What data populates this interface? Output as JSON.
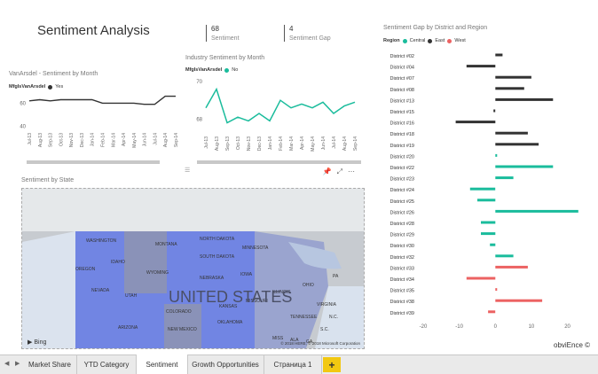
{
  "report": {
    "title": "Sentiment Analysis",
    "kpis": [
      {
        "value": "68",
        "label": "Sentiment"
      },
      {
        "value": "4",
        "label": "Sentiment Gap"
      }
    ],
    "branding": "obviEnce ©"
  },
  "vanarsdel_chart": {
    "title": "VanArsdel - Sentiment by Month",
    "legend_title": "MfgIsVanArsdel",
    "legend_item": "Yes",
    "color": "#333333",
    "chart_data": {
      "type": "line",
      "categories": [
        "Jul-13",
        "Aug-13",
        "Sep-13",
        "Oct-13",
        "Nov-13",
        "Dec-13",
        "Jan-14",
        "Feb-14",
        "Mar-14",
        "Apr-14",
        "May-14",
        "Jun-14",
        "Jul-14",
        "Aug-14",
        "Sep-14"
      ],
      "series": [
        {
          "name": "Yes",
          "values": [
            62,
            63,
            62,
            63,
            63,
            63,
            63,
            60,
            60,
            60,
            60,
            59,
            59,
            66,
            66
          ]
        }
      ],
      "ylim": [
        38,
        68
      ],
      "yticks": [
        "60",
        "40"
      ]
    }
  },
  "industry_chart": {
    "title": "Industry Sentiment by Month",
    "legend_title": "MfgIsVanArsdel",
    "legend_item": "No",
    "color": "#1abc9c",
    "chart_data": {
      "type": "line",
      "categories": [
        "Jul-13",
        "Aug-13",
        "Sep-13",
        "Oct-13",
        "Nov-13",
        "Dec-13",
        "Jan-14",
        "Feb-14",
        "Mar-14",
        "Apr-14",
        "May-14",
        "Jun-14",
        "Jul-14",
        "Aug-14",
        "Sep-14"
      ],
      "series": [
        {
          "name": "No",
          "values": [
            68.6,
            69.6,
            67.8,
            68.1,
            67.9,
            68.3,
            67.9,
            69.0,
            68.6,
            68.8,
            68.6,
            68.9,
            68.3,
            68.7,
            68.9
          ]
        }
      ],
      "ylim": [
        67.3,
        70.2
      ],
      "yticks": [
        "70",
        "68"
      ]
    }
  },
  "gap_chart": {
    "title": "Sentiment Gap by District and Region",
    "legend_title": "Region",
    "regions": [
      {
        "name": "Central",
        "color": "#1abc9c"
      },
      {
        "name": "East",
        "color": "#333333"
      },
      {
        "name": "West",
        "color": "#ec6262"
      }
    ],
    "chart_data": {
      "type": "bar",
      "orientation": "horizontal",
      "categories": [
        "District #02",
        "District #04",
        "District #07",
        "District #08",
        "District #13",
        "District #15",
        "District #16",
        "District #18",
        "District #19",
        "District #20",
        "District #22",
        "District #23",
        "District #24",
        "District #25",
        "District #26",
        "District #28",
        "District #29",
        "District #30",
        "District #32",
        "District #33",
        "District #34",
        "District #35",
        "District #38",
        "District #39"
      ],
      "values": [
        2,
        -8,
        10,
        8,
        16,
        -0.5,
        -11,
        9,
        12,
        0.5,
        16,
        5,
        -7,
        -5,
        23,
        -4,
        -4,
        -1.5,
        5,
        9,
        -8,
        0.5,
        13,
        -2
      ],
      "region": [
        "East",
        "East",
        "East",
        "East",
        "East",
        "East",
        "East",
        "East",
        "East",
        "Central",
        "Central",
        "Central",
        "Central",
        "Central",
        "Central",
        "Central",
        "Central",
        "Central",
        "Central",
        "West",
        "West",
        "West",
        "West",
        "West"
      ],
      "xlim": [
        -20,
        27
      ],
      "xticks": [
        -20,
        -10,
        0,
        10,
        20
      ]
    }
  },
  "map": {
    "title": "Sentiment by State",
    "country_label": "UNITED STATES",
    "states": [
      "WASHINGTON",
      "MONTANA",
      "NORTH DAKOTA",
      "MINNESOTA",
      "OREGON",
      "IDAHO",
      "SOUTH DAKOTA",
      "WYOMING",
      "NEBRASKA",
      "IOWA",
      "NEVADA",
      "UTAH",
      "COLORADO",
      "KANSAS",
      "MISSOURI",
      "ILLINOIS",
      "OHIO",
      "PA",
      "VIRGINIA",
      "OKLAHOMA",
      "TENNESSEE",
      "ARIZONA",
      "NEW MEXICO",
      "N.C.",
      "S.C.",
      "MISS",
      "ALA",
      "GA"
    ],
    "bing": "Bing",
    "copyright": "© 2018 HERE, © 2018 Microsoft Corporation"
  },
  "tabs": [
    {
      "label": "Market Share",
      "active": false
    },
    {
      "label": "YTD Category",
      "active": false
    },
    {
      "label": "Sentiment",
      "active": true
    },
    {
      "label": "Growth Opportunities",
      "active": false
    },
    {
      "label": "Страница 1",
      "active": false
    }
  ],
  "add_tab": "+"
}
